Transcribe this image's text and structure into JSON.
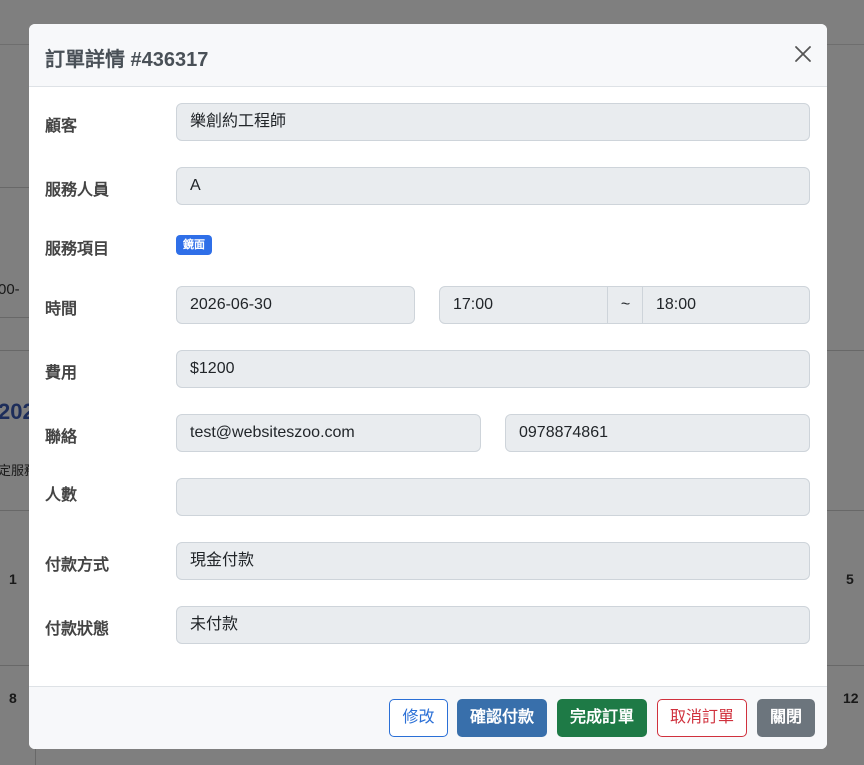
{
  "background": {
    "time_fragment": "00-",
    "year_fragment": "202",
    "service_fragment": "定服務",
    "day_numbers": {
      "d1": "1",
      "d5": "5",
      "d8": "8",
      "d12": "12"
    }
  },
  "modal": {
    "title": "訂單詳情 #436317",
    "close_icon": "close-icon",
    "fields": {
      "customer": {
        "label": "顧客",
        "value": "樂創約工程師"
      },
      "staff": {
        "label": "服務人員",
        "value": "A"
      },
      "service": {
        "label": "服務項目",
        "badge": "鏡面"
      },
      "time": {
        "label": "時間",
        "date": "2026-06-30",
        "start": "17:00",
        "separator": "~",
        "end": "18:00"
      },
      "fee": {
        "label": "費用",
        "value": "$1200"
      },
      "contact": {
        "label": "聯絡",
        "email": "test@websiteszoo.com",
        "phone": "0978874861"
      },
      "people": {
        "label": "人數",
        "value": ""
      },
      "payment_method": {
        "label": "付款方式",
        "value": "現金付款"
      },
      "payment_status": {
        "label": "付款狀態",
        "value": "未付款"
      }
    },
    "footer": {
      "edit": "修改",
      "confirm_payment": "確認付款",
      "complete_order": "完成訂單",
      "cancel_order": "取消訂單",
      "close": "關閉"
    }
  },
  "colors": {
    "badge": "#2f6fe8",
    "confirm_button": "#386fab",
    "complete_button": "#1e7a46",
    "cancel_button": "#d0313d",
    "close_button": "#6c757d"
  }
}
